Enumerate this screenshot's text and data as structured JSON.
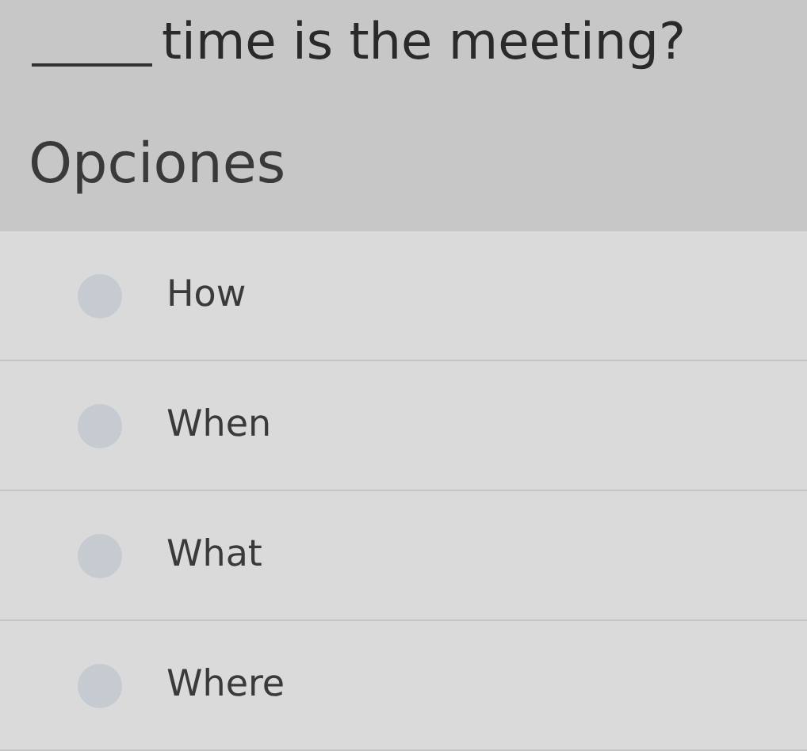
{
  "question": {
    "text": "time is the meeting?"
  },
  "options_heading": "Opciones",
  "options": [
    {
      "label": "How",
      "selected": false
    },
    {
      "label": "When",
      "selected": false
    },
    {
      "label": "What",
      "selected": false
    },
    {
      "label": "Where",
      "selected": false
    }
  ]
}
